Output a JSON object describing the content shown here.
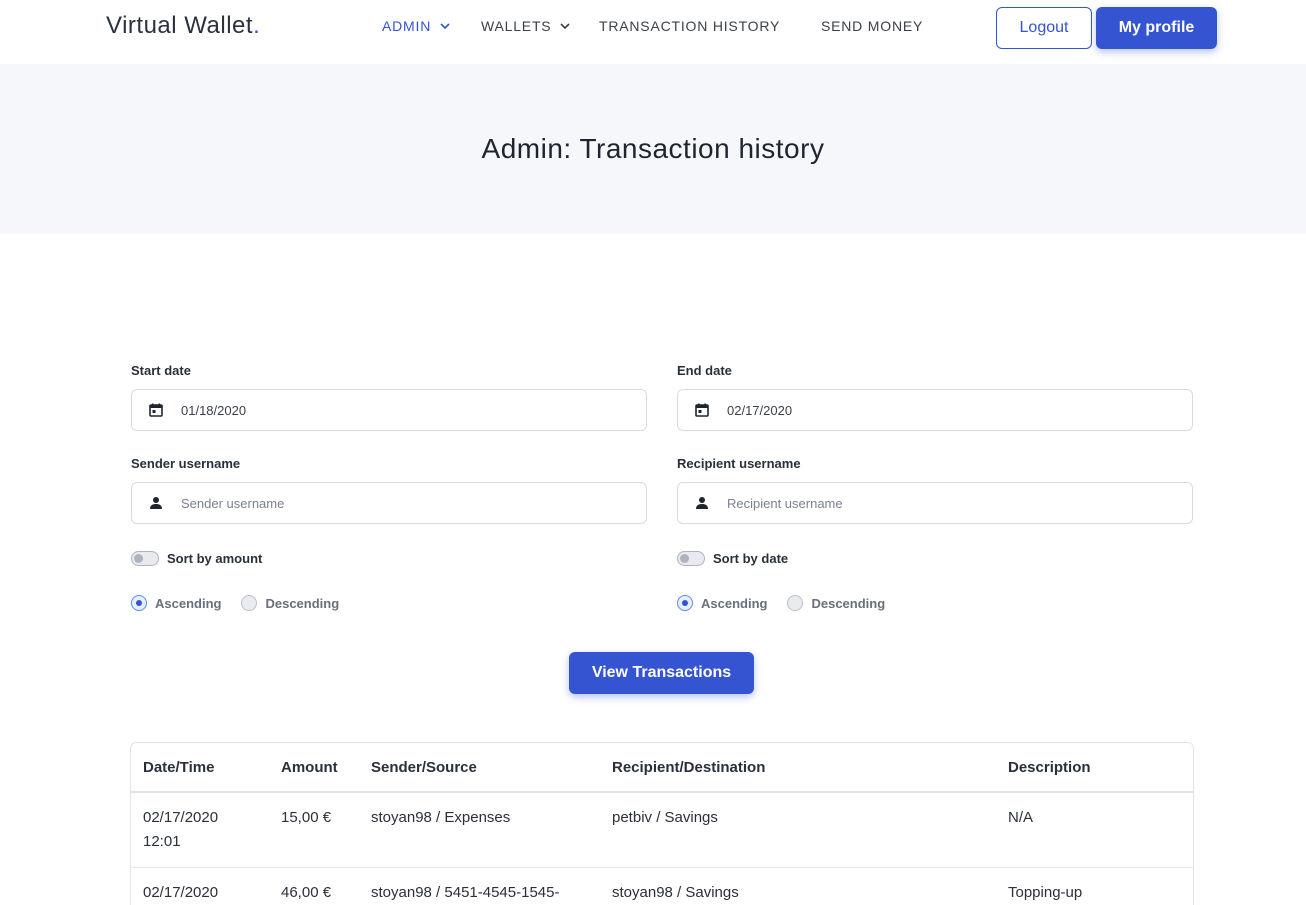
{
  "nav": {
    "brand": "Virtual Wallet",
    "brand_dot": ".",
    "items": [
      {
        "label": "ADMIN"
      },
      {
        "label": "WALLETS"
      },
      {
        "label": "TRANSACTION HISTORY"
      },
      {
        "label": "SEND MONEY"
      }
    ],
    "logout_label": "Logout",
    "profile_label": "My profile"
  },
  "hero": {
    "title": "Admin: Transaction history"
  },
  "filters": {
    "start_date": {
      "label": "Start date",
      "value": "01/18/2020"
    },
    "end_date": {
      "label": "End date",
      "value": "02/17/2020"
    },
    "sender": {
      "label": "Sender username",
      "placeholder": "Sender username"
    },
    "recipient": {
      "label": "Recipient username",
      "placeholder": "Recipient username"
    },
    "sort_amount": {
      "label": "Sort by amount",
      "ascending": "Ascending",
      "descending": "Descending"
    },
    "sort_date": {
      "label": "Sort by date",
      "ascending": "Ascending",
      "descending": "Descending"
    },
    "submit_label": "View Transactions"
  },
  "table": {
    "headers": [
      "Date/Time",
      "Amount",
      "Sender/Source",
      "Recipient/Destination",
      "Description"
    ],
    "rows": [
      {
        "date": "02/17/2020",
        "time": "12:01",
        "amount": "15,00 €",
        "sender": "stoyan98 / Expenses",
        "recipient": "petbiv / Savings",
        "description": "N/A"
      },
      {
        "date": "02/17/2020",
        "time": "",
        "amount": "46,00 €",
        "sender": "stoyan98 / 5451-4545-1545-",
        "recipient": "stoyan98 / Savings",
        "description": "Topping-up"
      }
    ]
  },
  "colors": {
    "accent": "#3454d1",
    "hero_bg": "#f5f7fa"
  }
}
